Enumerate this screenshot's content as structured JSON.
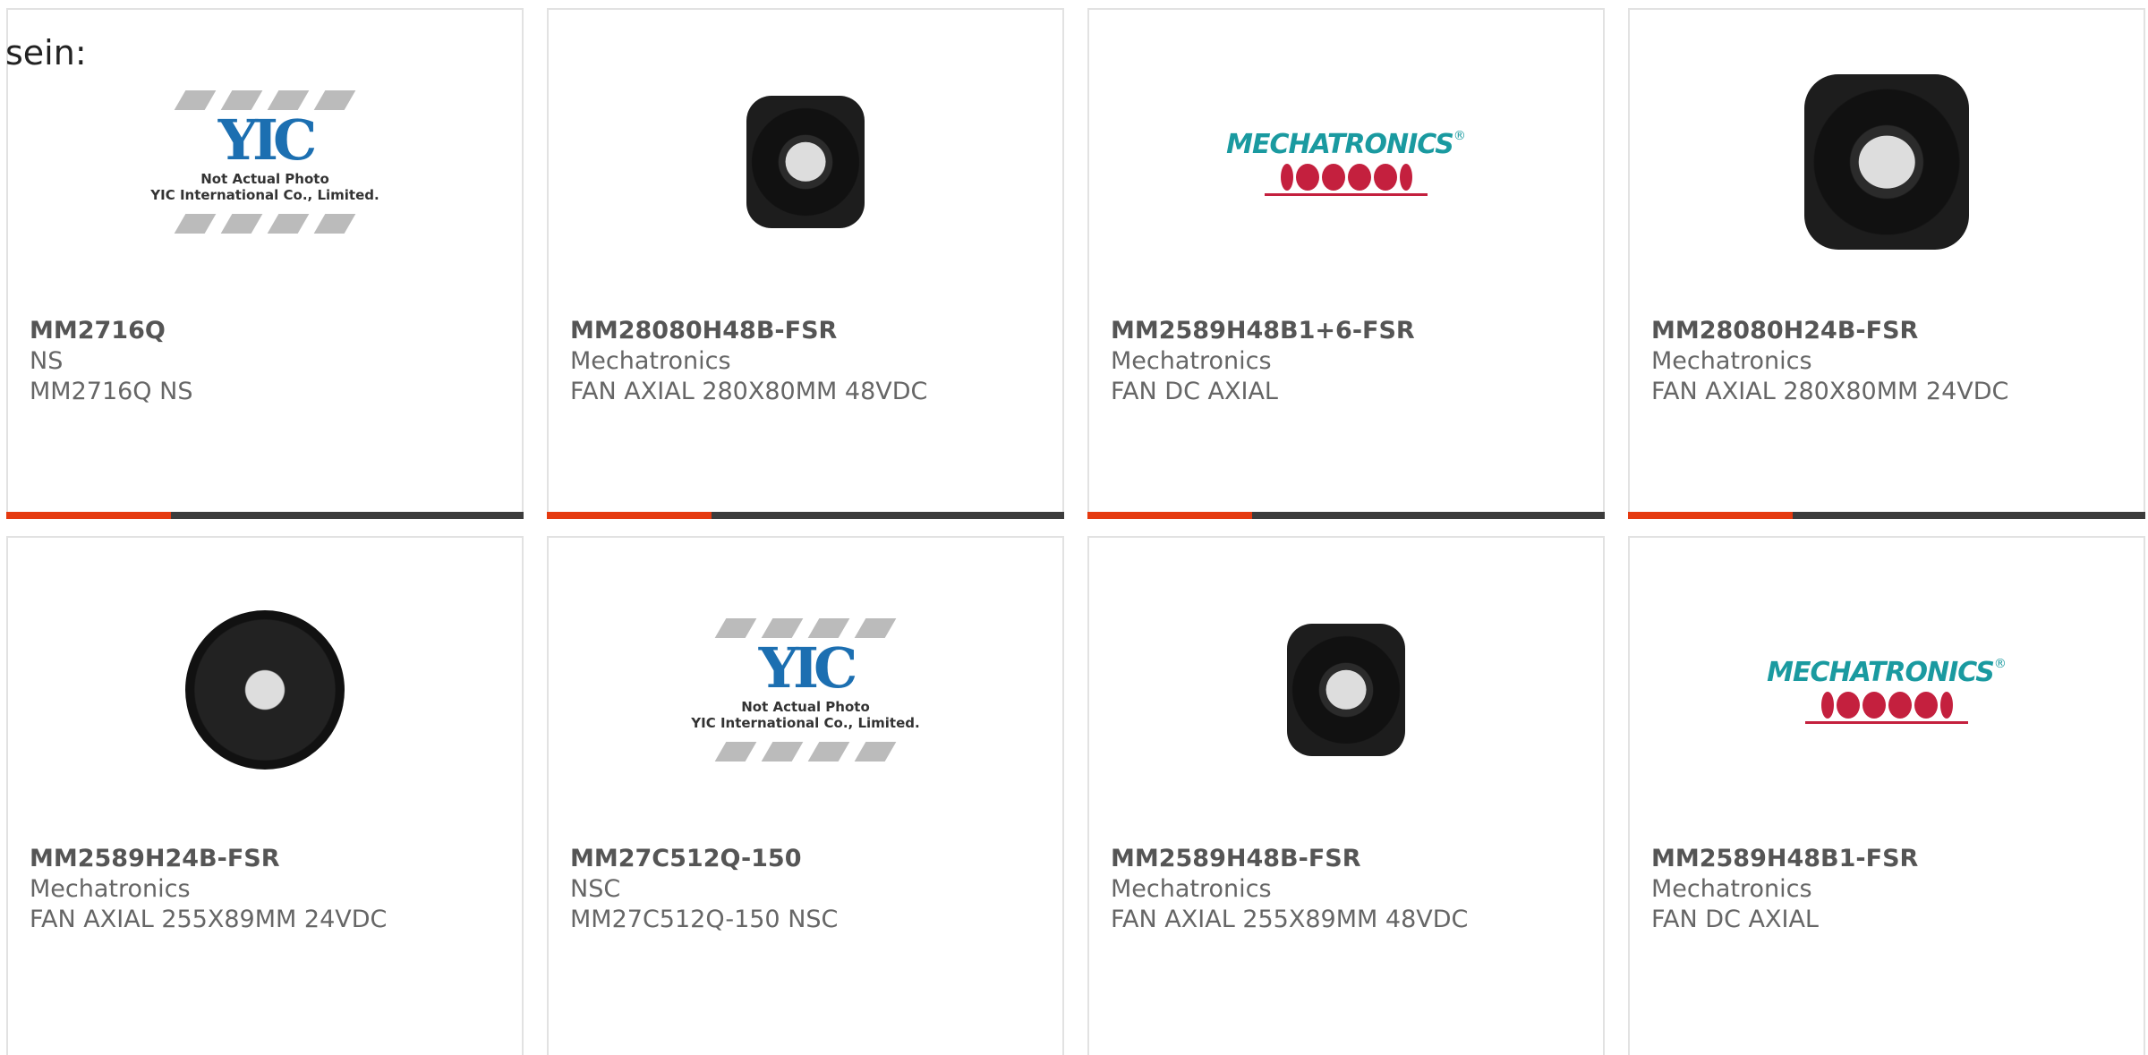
{
  "prefix_text": "sein:",
  "colors": {
    "accent": "#e53a10",
    "bar": "#3c3c3c",
    "border": "#e2e2e2"
  },
  "products": [
    {
      "part_number": "MM2716Q",
      "manufacturer": "NS",
      "description": "MM2716Q NS",
      "image": "placeholder-not-actual-photo",
      "image_caption": [
        "Not Actual Photo",
        "YIC International Co., Limited."
      ]
    },
    {
      "part_number": "MM28080H48B-FSR",
      "manufacturer": "Mechatronics",
      "description": "FAN AXIAL 280X80MM 48VDC",
      "image": "square-fan-photo"
    },
    {
      "part_number": "MM2589H48B1+6-FSR",
      "manufacturer": "Mechatronics",
      "description": "FAN DC AXIAL",
      "image": "mechatronics-logo",
      "logo_text": "MECHATRONICS"
    },
    {
      "part_number": "MM28080H24B-FSR",
      "manufacturer": "Mechatronics",
      "description": "FAN AXIAL 280X80MM 24VDC",
      "image": "square-fan-photo-large"
    },
    {
      "part_number": "MM2589H24B-FSR",
      "manufacturer": "Mechatronics",
      "description": "FAN AXIAL 255X89MM 24VDC",
      "image": "round-fan-photo"
    },
    {
      "part_number": "MM27C512Q-150",
      "manufacturer": "NSC",
      "description": "MM27C512Q-150 NSC",
      "image": "placeholder-not-actual-photo",
      "image_caption": [
        "Not Actual Photo",
        "YIC International Co., Limited."
      ]
    },
    {
      "part_number": "MM2589H48B-FSR",
      "manufacturer": "Mechatronics",
      "description": "FAN AXIAL 255X89MM 48VDC",
      "image": "square-fan-photo"
    },
    {
      "part_number": "MM2589H48B1-FSR",
      "manufacturer": "Mechatronics",
      "description": "FAN DC AXIAL",
      "image": "mechatronics-logo",
      "logo_text": "MECHATRONICS"
    }
  ]
}
